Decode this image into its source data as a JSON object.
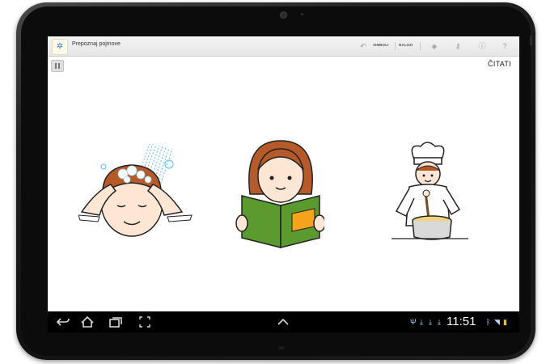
{
  "app": {
    "title": "Prepoznaj pojmove",
    "icon": "sun-star-icon"
  },
  "actionbar": {
    "undo_icon": "undo-icon",
    "simboli_label": "SIMBOLI",
    "nalozi_label": "NALOZI",
    "settings_icon": "target-icon",
    "key_icon": "key-icon",
    "info_icon": "info-icon",
    "help_icon": "question-icon"
  },
  "content": {
    "read_label": "ČITATI",
    "pause_icon": "pause-icon",
    "pictograms": [
      {
        "name": "pictogram-washing-hair"
      },
      {
        "name": "pictogram-reading"
      },
      {
        "name": "pictogram-cooking"
      }
    ]
  },
  "navbar": {
    "back_icon": "back-icon",
    "home_icon": "home-icon",
    "recent_icon": "recent-apps-icon",
    "screenshot_icon": "screenshot-icon",
    "up_icon": "chevron-up-icon"
  },
  "status": {
    "time": "11:51",
    "icons": [
      "usb-icon",
      "download-icon",
      "download-icon",
      "download-icon",
      "bluetooth-icon",
      "wifi-icon",
      "battery-icon"
    ]
  },
  "colors": {
    "book_green": "#5a9a2e",
    "book_orange": "#f7a21b",
    "hair_brown": "#b55a28",
    "water_blue": "#5bbfe8",
    "status_blue": "#b8d6ff"
  }
}
